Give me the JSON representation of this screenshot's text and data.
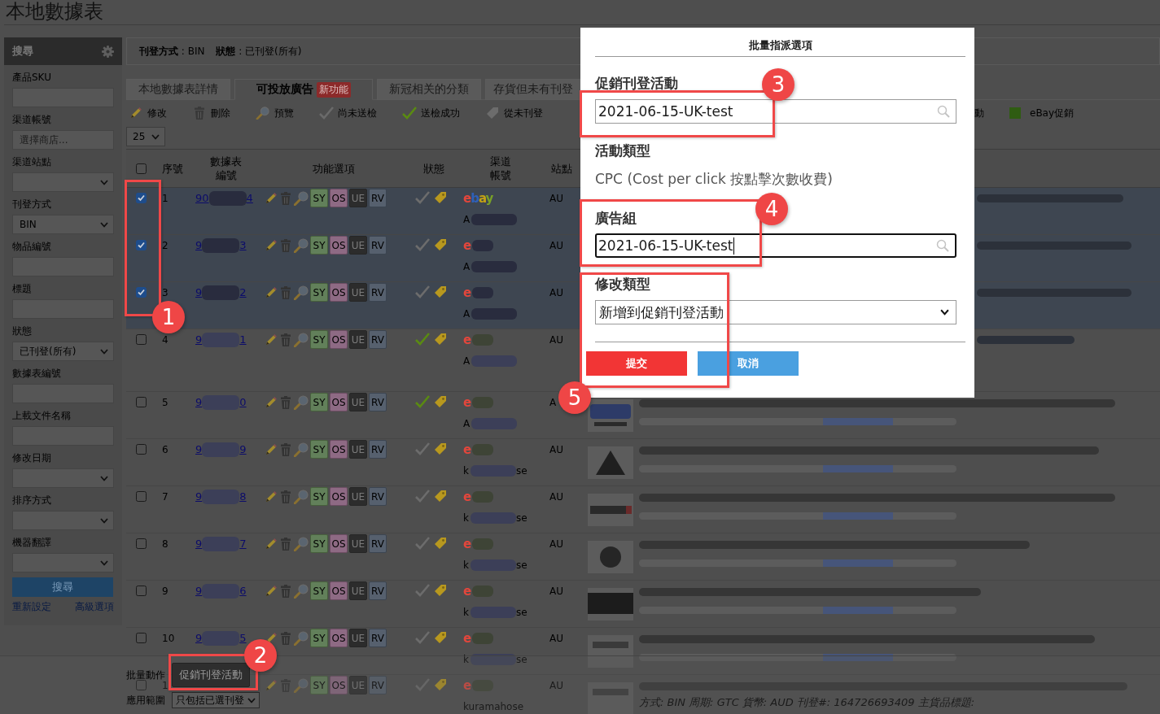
{
  "page_title": "本地數據表",
  "sidebar": {
    "title": "搜尋",
    "fields": [
      {
        "kind": "input",
        "label": "產品SKU"
      },
      {
        "kind": "input",
        "label": "渠道帳號",
        "placeholder": "選擇商店..."
      },
      {
        "kind": "select",
        "label": "渠道站點"
      },
      {
        "kind": "select",
        "label": "刊登方式",
        "value": "BIN"
      },
      {
        "kind": "input",
        "label": "物品編號"
      },
      {
        "kind": "input",
        "label": "標題"
      },
      {
        "kind": "select",
        "label": "狀態",
        "value": "已刊登(所有)"
      },
      {
        "kind": "input",
        "label": "數據表編號"
      },
      {
        "kind": "input",
        "label": "上載文件名稱"
      },
      {
        "kind": "select",
        "label": "修改日期"
      },
      {
        "kind": "select",
        "label": "排序方式"
      },
      {
        "kind": "select",
        "label": "機器翻譯"
      }
    ],
    "search_button": "搜尋",
    "links": [
      "重新設定",
      "高級選項"
    ]
  },
  "filter_summary": [
    "**刊登方式** : BIN",
    "**狀態** : 已刊登(所有)"
  ],
  "tabs": [
    {
      "label": "本地數據表詳情",
      "selected": false
    },
    {
      "label": "可投放廣告",
      "badge": "新功能",
      "selected": true
    },
    {
      "label": "新冠相关的分類",
      "selected": false
    },
    {
      "label": "存貨但未有刊登",
      "selected": false
    }
  ],
  "legend": [
    {
      "kind": "pencil",
      "label": "修改"
    },
    {
      "kind": "trash",
      "label": "刪除"
    },
    {
      "kind": "magnifier",
      "label": "預覽"
    },
    {
      "kind": "check-grey",
      "label": "尚未送檢"
    },
    {
      "kind": "check-green",
      "label": "送檢成功"
    },
    {
      "kind": "tag-grey",
      "label": "從未刊登"
    }
  ],
  "legend_right": [
    {
      "kind": "text",
      "label": "動"
    },
    {
      "kind": "square-green",
      "label": "eBay促銷"
    }
  ],
  "page_size": "25",
  "table": {
    "select_all_checked": false,
    "columns": [
      "序號",
      "數據表編號",
      "功能選項",
      "狀態",
      "渠道帳號",
      "站點"
    ],
    "rows": [
      {
        "checked": true,
        "seq": "1",
        "id_start": "90",
        "id_end": "4",
        "actions": [
          "SY",
          "OS",
          "UE",
          "RV"
        ],
        "submitted": false,
        "listed": true,
        "channel": "ebay",
        "channel_redacted": false,
        "account_start": "A",
        "account_redacted": true,
        "site": "AU"
      },
      {
        "checked": true,
        "seq": "2",
        "id_start": "9",
        "id_end": "3",
        "actions": [
          "SY",
          "OS",
          "UE",
          "RV"
        ],
        "submitted": false,
        "listed": true,
        "channel": "e",
        "channel_redacted": true,
        "account_start": "A",
        "account_redacted": true,
        "site": "AU"
      },
      {
        "checked": true,
        "seq": "3",
        "id_start": "9",
        "id_end": "2",
        "actions": [
          "SY",
          "OS",
          "UE",
          "RV"
        ],
        "submitted": false,
        "listed": true,
        "channel": "e",
        "channel_redacted": true,
        "account_start": "A",
        "account_redacted": true,
        "site": "AU"
      },
      {
        "checked": false,
        "seq": "4",
        "id_start": "9",
        "id_end": "1",
        "actions": [
          "SY",
          "OS",
          "UE",
          "RV"
        ],
        "submitted": true,
        "listed": true,
        "channel": "e",
        "channel_redacted": true,
        "account_start": "A",
        "account_redacted": true,
        "site": "AU"
      },
      {
        "checked": false,
        "seq": "5",
        "id_start": "9",
        "id_end": "0",
        "actions": [
          "SY",
          "OS",
          "UE",
          "RV"
        ],
        "submitted": true,
        "listed": true,
        "channel": "e",
        "channel_redacted": true,
        "account_start": "A",
        "account_redacted": true,
        "site": "A"
      },
      {
        "checked": false,
        "seq": "6",
        "id_start": "9",
        "id_end": "9",
        "actions": [
          "SY",
          "OS",
          "UE",
          "RV"
        ],
        "submitted": false,
        "listed": true,
        "channel": "e",
        "channel_redacted": true,
        "account_start": "k",
        "account_redacted": true,
        "account_end": "se",
        "site": "AU"
      },
      {
        "checked": false,
        "seq": "7",
        "id_start": "9",
        "id_end": "8",
        "actions": [
          "SY",
          "OS",
          "UE",
          "RV"
        ],
        "submitted": false,
        "listed": true,
        "channel": "e",
        "channel_redacted": true,
        "account_start": "k",
        "account_redacted": true,
        "account_end": "se",
        "site": "AU"
      },
      {
        "checked": false,
        "seq": "8",
        "id_start": "9",
        "id_end": "7",
        "actions": [
          "SY",
          "OS",
          "UE",
          "RV"
        ],
        "submitted": false,
        "listed": true,
        "channel": "e",
        "channel_redacted": true,
        "account_start": "k",
        "account_redacted": true,
        "account_end": "se",
        "site": "AU"
      },
      {
        "checked": false,
        "seq": "9",
        "id_start": "9",
        "id_end": "6",
        "actions": [
          "SY",
          "OS",
          "UE",
          "RV"
        ],
        "submitted": false,
        "listed": true,
        "channel": "e",
        "channel_redacted": true,
        "account_start": "k",
        "account_redacted": true,
        "account_end": "se",
        "site": "AU"
      },
      {
        "checked": false,
        "seq": "10",
        "id_start": "9",
        "id_end": "5",
        "actions": [
          "SY",
          "OS",
          "UE",
          "RV"
        ],
        "submitted": false,
        "listed": true,
        "channel": "e",
        "channel_redacted": true,
        "account_start": "k",
        "account_redacted": true,
        "account_end": "se",
        "site": "AU"
      },
      {
        "checked": false,
        "seq": "1",
        "actions": [
          "SY",
          "OS",
          "UE",
          "RV"
        ],
        "submitted": false,
        "listed": true,
        "channel": "e",
        "channel_redacted": true,
        "account_start": "kuramahose",
        "account_redacted": false,
        "site": "AU",
        "detail": "方式: BIN 周期: GTC 貨幣: AUD 刊登#: 164726693409 主貨品標題:"
      }
    ]
  },
  "footer": {
    "bulk_label": "批量動作",
    "bulk_button": "促銷刊登活動",
    "scope_label": "應用範圍",
    "scope_value": "只包括已選刊登"
  },
  "modal": {
    "title": "批量指派選項",
    "fields": [
      {
        "kind": "search",
        "label": "促銷刊登活動",
        "value": "2021-06-15-UK-test",
        "focused": false
      },
      {
        "kind": "text",
        "label": "活動類型",
        "value": "CPC (Cost per click 按點擊次數收費)"
      },
      {
        "kind": "search",
        "label": "廣告組",
        "value": "2021-06-15-UK-test",
        "focused": true
      },
      {
        "kind": "select",
        "label": "修改類型",
        "value": "新增到促銷刊登活動"
      }
    ],
    "submit": "提交",
    "cancel": "取消"
  },
  "annotations": [
    {
      "number": "1"
    },
    {
      "number": "2"
    },
    {
      "number": "3"
    },
    {
      "number": "4"
    },
    {
      "number": "5"
    }
  ]
}
